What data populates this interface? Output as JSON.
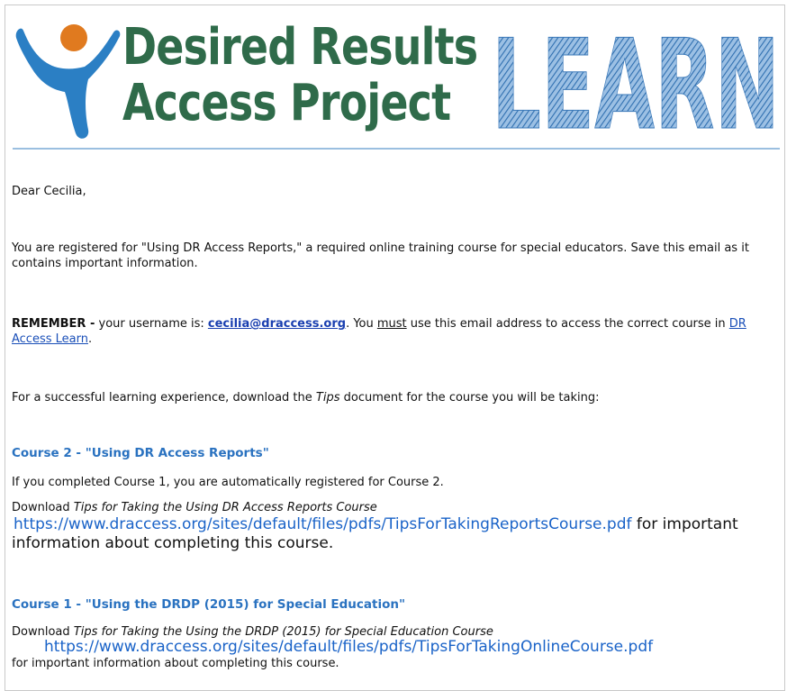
{
  "banner": {
    "title_line1": "Desired Results",
    "title_line2": "Access Project",
    "learn_word": "LEARN",
    "colors": {
      "green": "#2f6b4a",
      "blue": "#2b7fc4",
      "orange": "#e07a1f",
      "learn_blue": "#3a78b8"
    }
  },
  "email": {
    "greeting": "Dear Cecilia,",
    "intro": "You are registered for \"Using DR Access Reports,\" a required online training course for special educators. Save this email as it contains important information.",
    "remember_label": "REMEMBER -",
    "remember_text1": " your username is: ",
    "username": "cecilia@draccess.org",
    "remember_text2": ". You ",
    "must": "must",
    "remember_text3": " use this email address to access the correct course in ",
    "learn_link": "DR Access Learn",
    "remember_end": ".",
    "tips_text1": "For a successful learning experience, download the ",
    "tips_italic": "Tips",
    "tips_text2": " document for the course you will be taking:",
    "course2": {
      "heading": "Course 2 -  \"Using DR Access Reports\"",
      "auto_note": "If you completed Course 1, you are automatically registered for Course 2.",
      "download": "Download ",
      "tips_title": "Tips for Taking the Using DR Access Reports Course",
      "url": "https://www.draccess.org/sites/default/files/pdfs/TipsForTakingReportsCourse.pdf",
      "suffix": " for important information about completing this course."
    },
    "course1": {
      "heading": "Course 1 - \"Using the DRDP (2015) for Special Education\"",
      "download": "Download ",
      "tips_title": "Tips for Taking the Using the DRDP (2015) for Special Education Course",
      "url": "https://www.draccess.org/sites/default/files/pdfs/TipsForTakingOnlineCourse.pdf",
      "suffix": "for important information about completing this course."
    }
  }
}
